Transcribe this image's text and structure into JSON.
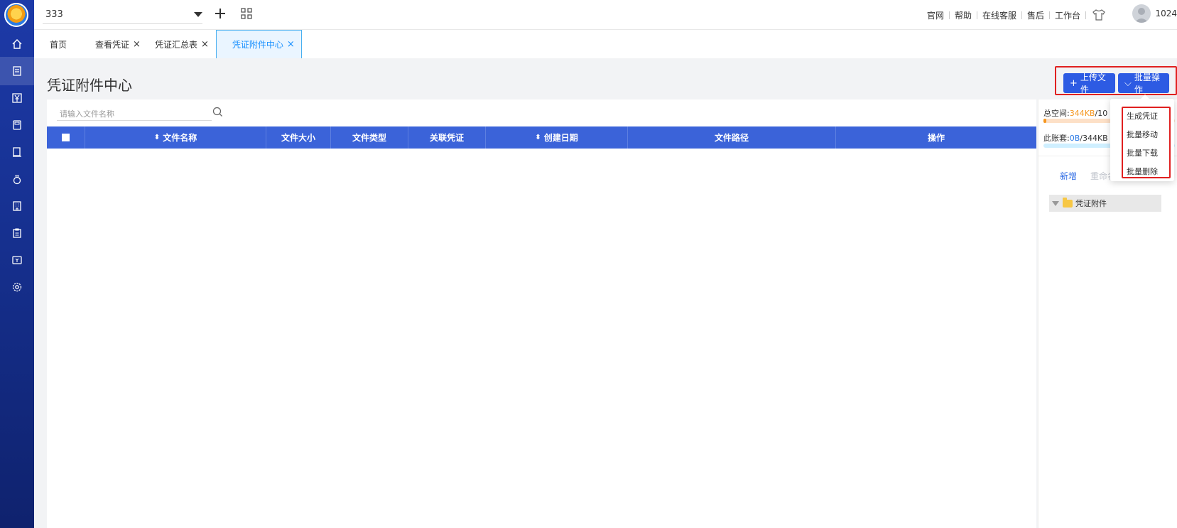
{
  "sidebar": {
    "logo": "app-logo",
    "items": [
      {
        "icon": "home-icon"
      },
      {
        "icon": "voucher-icon",
        "active": true
      },
      {
        "icon": "yen-icon"
      },
      {
        "icon": "calculator-icon"
      },
      {
        "icon": "ledger-icon"
      },
      {
        "icon": "asset-icon"
      },
      {
        "icon": "building-icon"
      },
      {
        "icon": "report-icon"
      },
      {
        "icon": "tax-icon"
      },
      {
        "icon": "settings-icon"
      }
    ]
  },
  "topbar": {
    "company": "333",
    "links": [
      "官网",
      "帮助",
      "在线客服",
      "售后",
      "工作台"
    ],
    "user_id": "1024"
  },
  "tabs": [
    {
      "label": "首页",
      "closable": false
    },
    {
      "label": "查看凭证",
      "closable": true
    },
    {
      "label": "凭证汇总表",
      "closable": true
    },
    {
      "label": "凭证附件中心",
      "closable": true,
      "active": true
    }
  ],
  "tab_close_glyph": "×",
  "page": {
    "title": "凭证附件中心",
    "upload_label": "上传文件",
    "batch_label": "批量操作",
    "upload_glyph": "+",
    "batch_glyph": "⌵"
  },
  "search": {
    "placeholder": "请输入文件名称"
  },
  "table": {
    "columns": [
      "",
      "文件名称",
      "文件大小",
      "文件类型",
      "关联凭证",
      "创建日期",
      "文件路径",
      "操作"
    ],
    "sort_glyph": "⬍",
    "rows": []
  },
  "storage": {
    "total_label": "总空间:",
    "total_used": "344KB",
    "total_rest": "/10",
    "account_label": "此账套:",
    "account_used": "0B",
    "account_rest": "/344KB",
    "total_fraction": 0.01
  },
  "folder_panel": {
    "new_label": "新增",
    "rename_label": "重命名",
    "root_folder": "凭证附件"
  },
  "batch_menu": [
    "生成凭证",
    "批量移动",
    "批量下载",
    "批量删除"
  ],
  "colors": {
    "primary": "#2d5be3",
    "header": "#3b63d9",
    "highlight": "#e02020",
    "sidebar": "#1d3aa8"
  }
}
